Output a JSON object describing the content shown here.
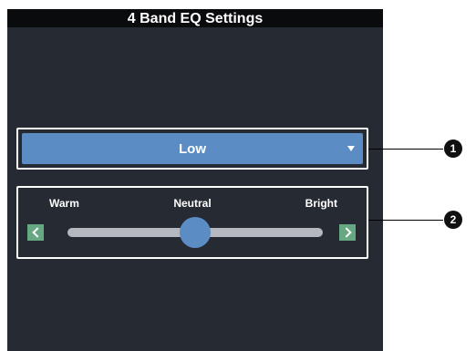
{
  "title": "4 Band EQ Settings",
  "band_dropdown": {
    "selected": "Low"
  },
  "tone_slider": {
    "left_label": "Warm",
    "center_label": "Neutral",
    "right_label": "Bright",
    "value_fraction": 0.5
  },
  "callouts": [
    "1",
    "2"
  ],
  "colors": {
    "background": "#252a33",
    "title_bar": "#0a0b0d",
    "accent_blue": "#5b8dc4",
    "step_button_green": "#66a882",
    "track_gray": "#b5b9bf"
  }
}
